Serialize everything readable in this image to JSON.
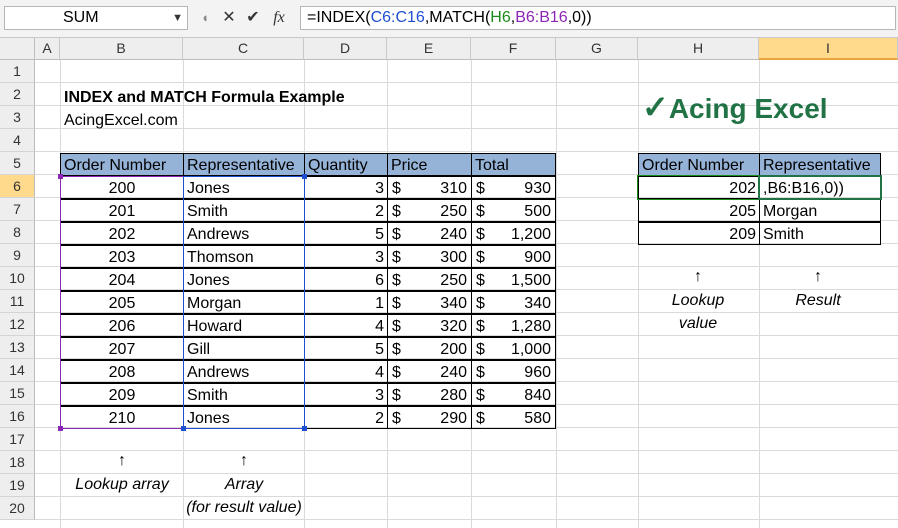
{
  "formula_bar": {
    "name_box": "SUM",
    "cancel_icon": "✕",
    "enter_icon": "✔",
    "fx_label": "fx",
    "formula_parts": [
      "=INDEX(",
      "C6:C16",
      ",MATCH(",
      "H6",
      ",",
      "B6:B16",
      ",0))"
    ]
  },
  "columns": [
    "A",
    "B",
    "C",
    "D",
    "E",
    "F",
    "G",
    "H",
    "I"
  ],
  "rows": [
    "1",
    "2",
    "3",
    "4",
    "5",
    "6",
    "7",
    "8",
    "9",
    "10",
    "11",
    "12",
    "13",
    "14",
    "15",
    "16",
    "17",
    "18",
    "19",
    "20"
  ],
  "title": "INDEX and MATCH Formula Example",
  "subtitle": "AcingExcel.com",
  "logo": {
    "check": "✓",
    "text": "Acing Excel"
  },
  "main_table": {
    "headers": [
      "Order Number",
      "Representative",
      "Quantity",
      "Price",
      "Total"
    ],
    "currency": "$",
    "rows": [
      {
        "order": "200",
        "rep": "Jones",
        "qty": "3",
        "price": "310",
        "total": "930"
      },
      {
        "order": "201",
        "rep": "Smith",
        "qty": "2",
        "price": "250",
        "total": "500"
      },
      {
        "order": "202",
        "rep": "Andrews",
        "qty": "5",
        "price": "240",
        "total": "1,200"
      },
      {
        "order": "203",
        "rep": "Thomson",
        "qty": "3",
        "price": "300",
        "total": "900"
      },
      {
        "order": "204",
        "rep": "Jones",
        "qty": "6",
        "price": "250",
        "total": "1,500"
      },
      {
        "order": "205",
        "rep": "Morgan",
        "qty": "1",
        "price": "340",
        "total": "340"
      },
      {
        "order": "206",
        "rep": "Howard",
        "qty": "4",
        "price": "320",
        "total": "1,280"
      },
      {
        "order": "207",
        "rep": "Gill",
        "qty": "5",
        "price": "200",
        "total": "1,000"
      },
      {
        "order": "208",
        "rep": "Andrews",
        "qty": "4",
        "price": "240",
        "total": "960"
      },
      {
        "order": "209",
        "rep": "Smith",
        "qty": "3",
        "price": "280",
        "total": "840"
      },
      {
        "order": "210",
        "rep": "Jones",
        "qty": "2",
        "price": "290",
        "total": "580"
      }
    ]
  },
  "lookup_table": {
    "headers": [
      "Order Number",
      "Representative"
    ],
    "rows": [
      {
        "order": "202",
        "rep": ",B6:B16,0))"
      },
      {
        "order": "205",
        "rep": "Morgan"
      },
      {
        "order": "209",
        "rep": "Smith"
      }
    ]
  },
  "annotations": {
    "arrow": "↑",
    "lookup_array": "Lookup array",
    "array": "Array",
    "array_sub": "(for result value)",
    "lookup_value_1": "Lookup",
    "lookup_value_2": "value",
    "result": "Result"
  },
  "colors": {
    "header_fill": "#95b3d7",
    "excel_green": "#217346",
    "ref_blue": "#1f4fd1",
    "ref_green": "#1a8c1a",
    "ref_purple": "#8b27b5"
  }
}
